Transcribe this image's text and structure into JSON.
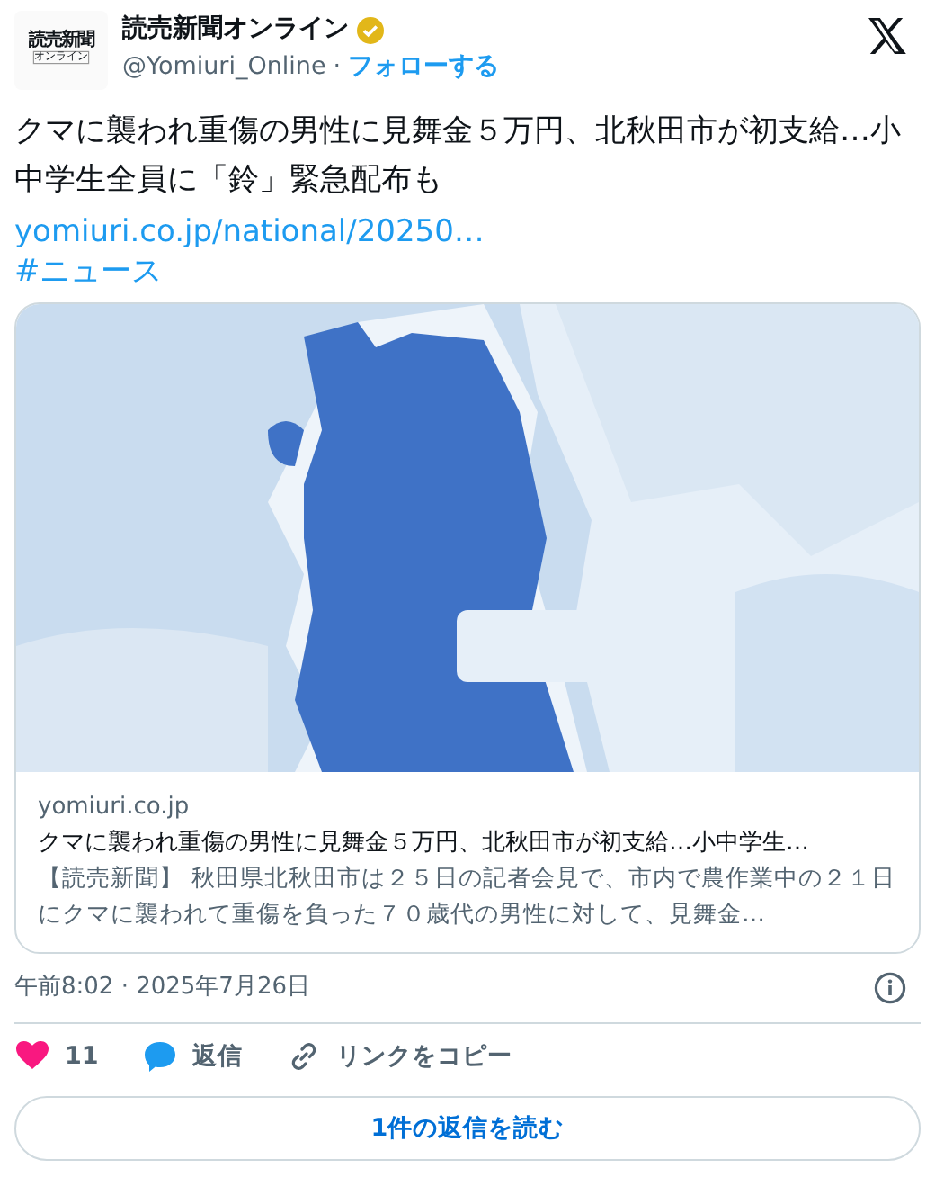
{
  "account": {
    "logo_top": "読売新聞",
    "logo_bottom": "オンライン",
    "name": "読売新聞オンライン",
    "verified": true,
    "handle": "@Yomiuri_Online",
    "separator": "·",
    "follow": "フォローする"
  },
  "tweet": {
    "text": "クマに襲われ重傷の男性に見舞金５万円、北秋田市が初支給…小中学生全員に「鈴」緊急配布も",
    "link": "yomiuri.co.jp/national/20250…",
    "hashtag": "#ニュース"
  },
  "card": {
    "domain": "yomiuri.co.jp",
    "title": "クマに襲われ重傷の男性に見舞金５万円、北秋田市が初支給…小中学生…",
    "description": "【読売新聞】 秋田県北秋田市は２５日の記者会見で、市内で農作業中の２１日にクマに襲われて重傷を負った７０歳代の男性に対して、見舞金…"
  },
  "timestamp": "午前8:02 · 2025年7月26日",
  "actions": [
    {
      "kind": "like",
      "label": "11"
    },
    {
      "kind": "reply",
      "label": "返信"
    },
    {
      "kind": "copy",
      "label": "リンクをコピー"
    }
  ],
  "read_replies": "1件の返信を読む"
}
